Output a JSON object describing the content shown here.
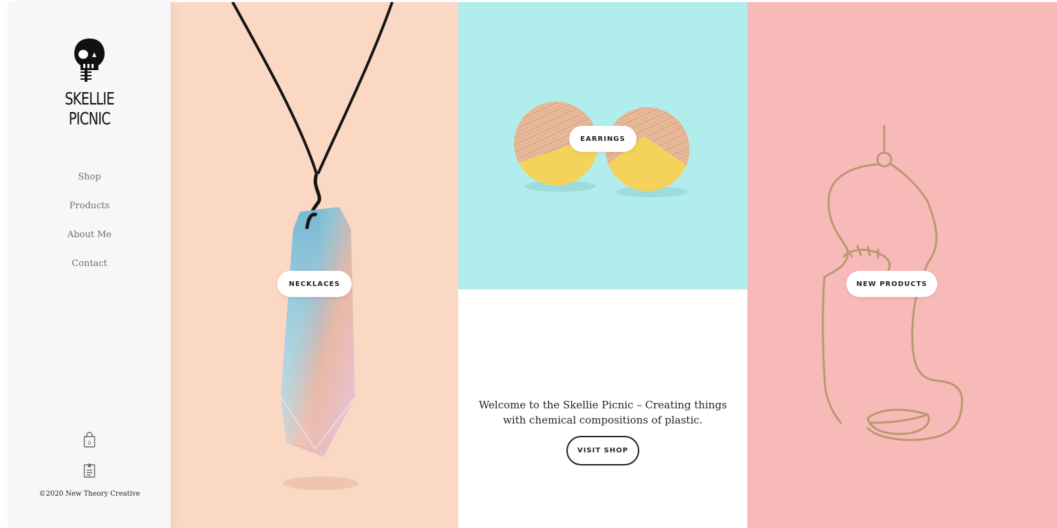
{
  "brand": {
    "name_line1": "SKELLIE",
    "name_line2": "PICNIC",
    "logo_icon": "skull-icon"
  },
  "nav": {
    "items": [
      {
        "label": "Shop"
      },
      {
        "label": "Products"
      },
      {
        "label": "About Me"
      },
      {
        "label": "Contact"
      }
    ]
  },
  "sidebar_icons": {
    "cart_icon": "shopping-bag-icon",
    "cart_count": "0",
    "wishlist_icon": "clipboard-star-icon"
  },
  "footer": {
    "copyright": "©2020 New Theory Creative"
  },
  "panels": {
    "necklaces": {
      "label": "NECKLACES",
      "bg": "#fbd8c4"
    },
    "earrings": {
      "label": "EARRINGS",
      "bg": "#b2edee"
    },
    "new_products": {
      "label": "NEW PRODUCTS",
      "bg": "#f8b9b9"
    }
  },
  "welcome": {
    "line1": "Welcome to the Skellie Picnic – Creating things",
    "line2": "with chemical compositions of plastic.",
    "button_label": "VISIT SHOP"
  }
}
